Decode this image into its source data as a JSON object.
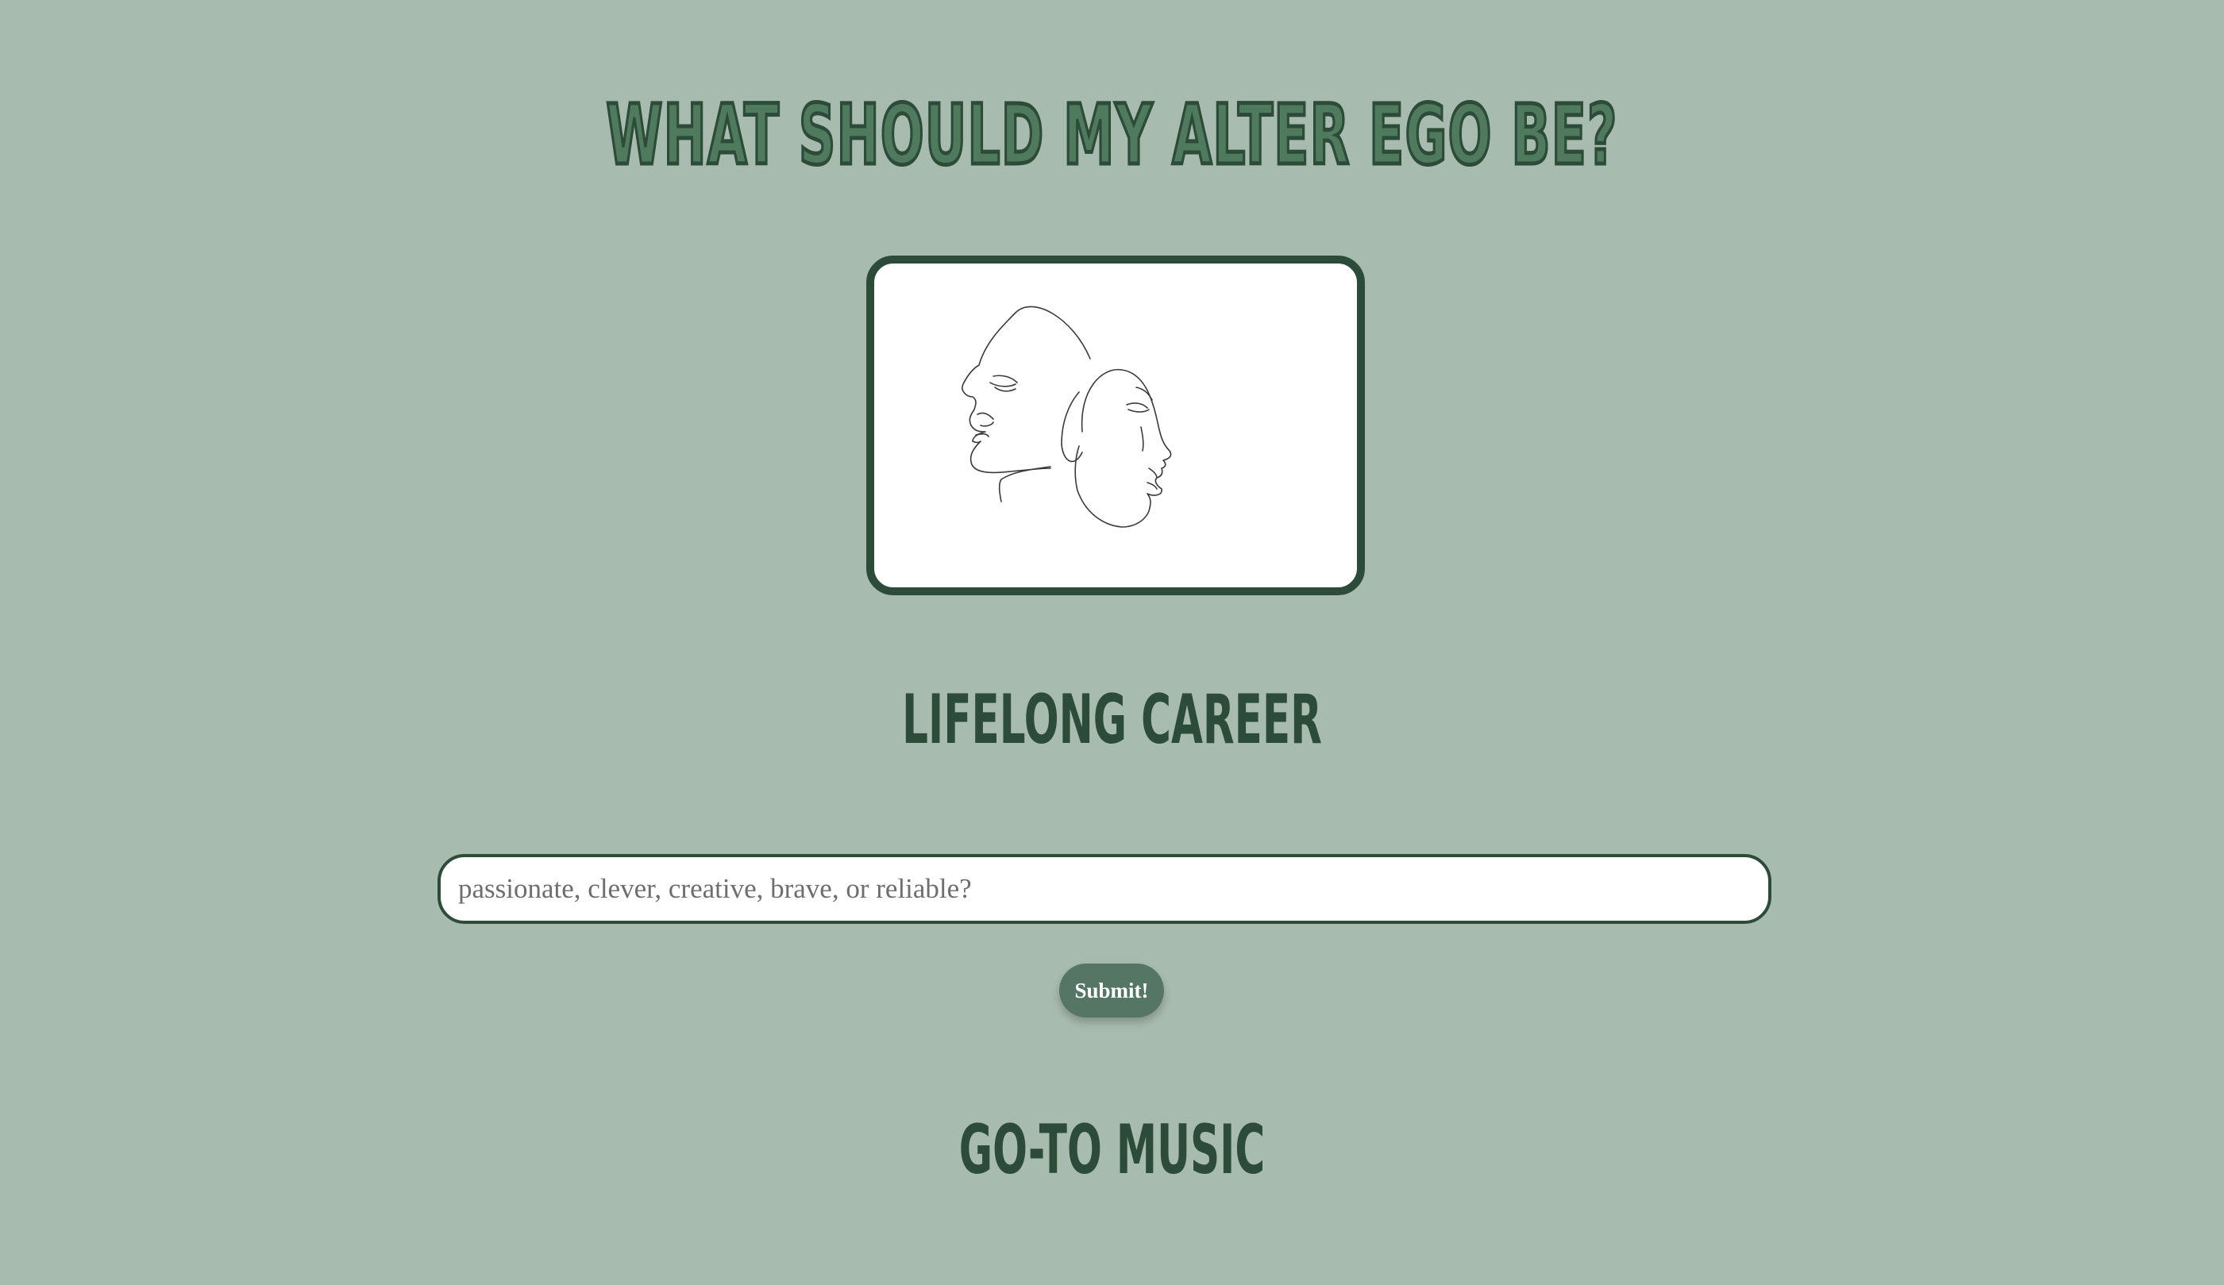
{
  "page": {
    "title": "WHAT SHOULD MY ALTER EGO BE?",
    "background_color": "#a8bbaf",
    "accent_color": "#2d4b39",
    "button_color": "#557665"
  },
  "hero": {
    "image": "two-faces-line-art"
  },
  "sections": {
    "career_title": "LIFELONG CAREER",
    "music_title": "GO-TO MUSIC"
  },
  "form": {
    "input_placeholder": "passionate, clever, creative, brave, or reliable?",
    "input_value": "",
    "submit_label": "Submit!"
  }
}
